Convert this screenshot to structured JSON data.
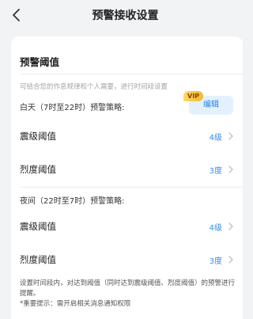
{
  "header": {
    "title": "预警接收设置"
  },
  "card": {
    "title": "预警阈值",
    "hint": "可结合您的作息规律和个人需要，进行时间段设置",
    "day": {
      "label": "白天（7时至22时）预警策略:",
      "vip_badge": "VIP",
      "edit_label": "编辑",
      "rows": [
        {
          "label": "震级阈值",
          "value": "4级"
        },
        {
          "label": "烈度阈值",
          "value": "3度"
        }
      ]
    },
    "night": {
      "label": "夜间（22时至7时）预警策略:",
      "rows": [
        {
          "label": "震级阈值",
          "value": "4级"
        },
        {
          "label": "烈度阈值",
          "value": "3度"
        }
      ]
    },
    "footnote": "设置时间段内，对达到阈值（同时达到震级阈值、烈度阈值）的预警进行提醒。",
    "important": "*重要提示：需开启相关消息通知权限"
  },
  "colors": {
    "accent": "#3b8ae6",
    "edit_bg": "#e3f1ff",
    "vip": "#f3b82a",
    "page_bg": "#f2f3f5"
  },
  "icons": {
    "back": "chevron-left-icon",
    "row_arrow": "chevron-right-icon"
  }
}
